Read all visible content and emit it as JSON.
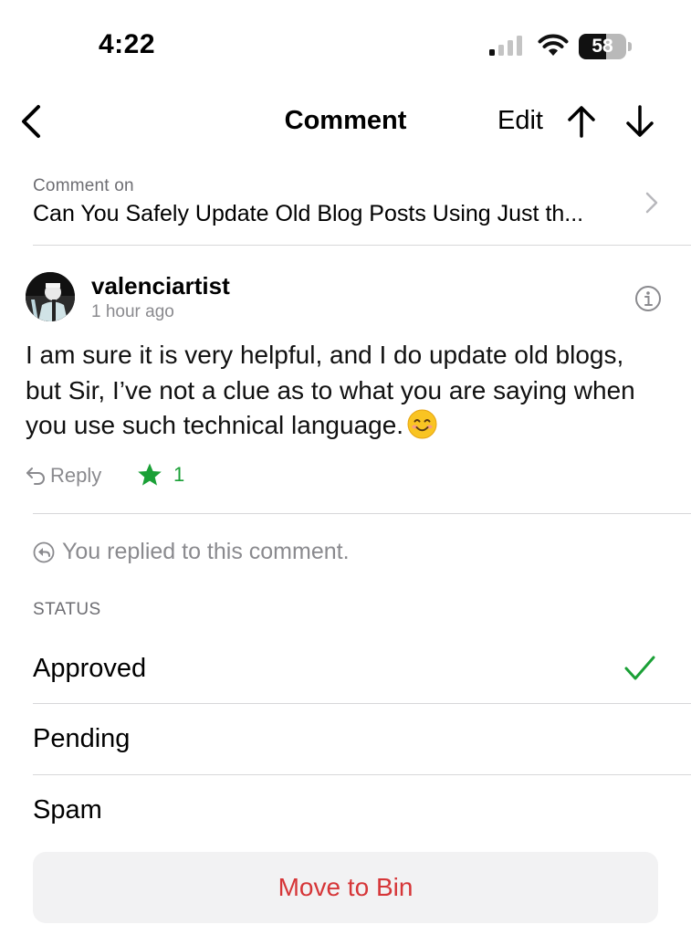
{
  "status_bar": {
    "time": "4:22",
    "battery": "58",
    "icons": [
      "signal-icon",
      "wifi-icon",
      "battery-icon"
    ]
  },
  "nav": {
    "title": "Comment",
    "edit_label": "Edit",
    "icons": [
      "back-chevron-icon",
      "arrow-up-icon",
      "arrow-down-icon"
    ]
  },
  "comment_on": {
    "label": "Comment on",
    "post_title": "Can You Safely Update Old Blog Posts Using Just th..."
  },
  "comment": {
    "author": "valenciartist",
    "time": "1 hour ago",
    "body": "I am sure it is very helpful, and I do update old blogs, but Sir, I’ve not a clue as to what you are saying when you use such technical language.",
    "reply_label": "Reply",
    "like_count": "1"
  },
  "replied_notice": "You replied to this comment.",
  "status": {
    "header": "STATUS",
    "options": [
      {
        "label": "Approved",
        "selected": true
      },
      {
        "label": "Pending",
        "selected": false
      },
      {
        "label": "Spam",
        "selected": false
      }
    ]
  },
  "bin_label": "Move to Bin",
  "colors": {
    "accent_green": "#1aa036",
    "danger_red": "#d63638",
    "secondary_text": "#8a8a8e"
  }
}
